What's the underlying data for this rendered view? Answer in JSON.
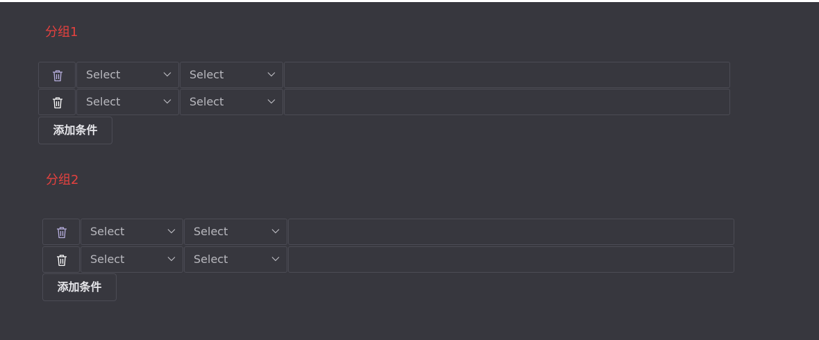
{
  "groups": [
    {
      "title": "分组1",
      "conditions": [
        {
          "field_placeholder": "Select",
          "operator_placeholder": "Select",
          "value": ""
        },
        {
          "field_placeholder": "Select",
          "operator_placeholder": "Select",
          "value": ""
        }
      ],
      "add_label": "添加条件"
    },
    {
      "title": "分组2",
      "conditions": [
        {
          "field_placeholder": "Select",
          "operator_placeholder": "Select",
          "value": ""
        },
        {
          "field_placeholder": "Select",
          "operator_placeholder": "Select",
          "value": ""
        }
      ],
      "add_label": "添加条件"
    }
  ],
  "colors": {
    "background": "#37373e",
    "group_title": "#e5413f",
    "trash_icon_first_row": "#b8b0e0",
    "trash_icon": "#ffffff"
  },
  "icons": {
    "delete": "trash-icon",
    "dropdown": "chevron-down-icon"
  }
}
